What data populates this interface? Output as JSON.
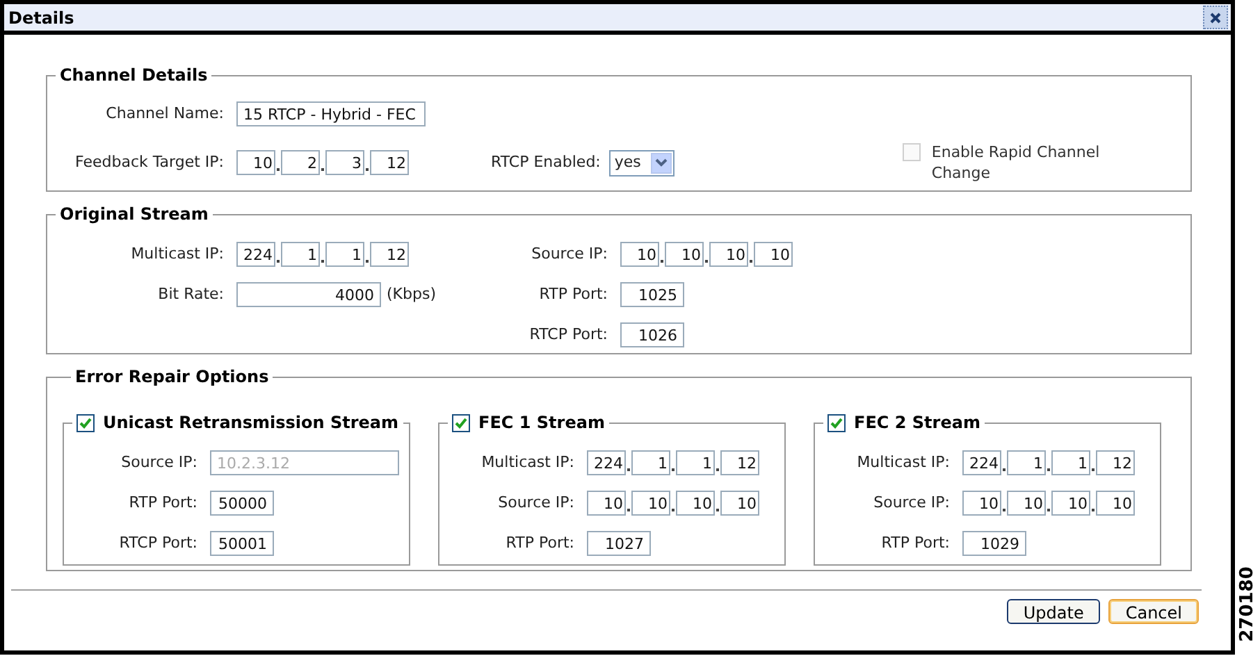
{
  "window": {
    "title": "Details"
  },
  "channel_details": {
    "legend": "Channel Details",
    "channel_name": {
      "label": "Channel Name:",
      "value": "15 RTCP - Hybrid - FEC"
    },
    "feedback_target_ip": {
      "label": "Feedback Target IP:",
      "octets": [
        "10",
        "2",
        "3",
        "12"
      ]
    },
    "rtcp_enabled": {
      "label": "RTCP Enabled:",
      "value": "yes"
    },
    "rapid_channel_change": {
      "label": "Enable Rapid Channel Change",
      "checked": false,
      "disabled": true
    }
  },
  "original_stream": {
    "legend": "Original Stream",
    "left": [
      {
        "kind": "ip",
        "label": "Multicast IP:",
        "octets": [
          "224",
          "1",
          "1",
          "12"
        ]
      },
      {
        "kind": "unit",
        "label": "Bit Rate:",
        "value": "4000",
        "unit": "(Kbps)"
      }
    ],
    "right": [
      {
        "kind": "ip",
        "label": "Source IP:",
        "octets": [
          "10",
          "10",
          "10",
          "10"
        ]
      },
      {
        "kind": "port",
        "label": "RTP Port:",
        "value": "1025"
      },
      {
        "kind": "port",
        "label": "RTCP Port:",
        "value": "1026"
      }
    ]
  },
  "error_repair": {
    "legend": "Error Repair Options",
    "streams": [
      {
        "title": "Unicast Retransmission Stream",
        "checked": true,
        "fields": [
          {
            "kind": "text",
            "label": "Source IP:",
            "value": "10.2.3.12",
            "disabled": true
          },
          {
            "kind": "port",
            "label": "RTP Port:",
            "value": "50000"
          },
          {
            "kind": "port",
            "label": "RTCP Port:",
            "value": "50001"
          }
        ]
      },
      {
        "title": "FEC 1 Stream",
        "checked": true,
        "fields": [
          {
            "kind": "ip",
            "label": "Multicast IP:",
            "octets": [
              "224",
              "1",
              "1",
              "12"
            ]
          },
          {
            "kind": "ip",
            "label": "Source IP:",
            "octets": [
              "10",
              "10",
              "10",
              "10"
            ]
          },
          {
            "kind": "port",
            "label": "RTP Port:",
            "value": "1027"
          }
        ]
      },
      {
        "title": "FEC 2 Stream",
        "checked": true,
        "fields": [
          {
            "kind": "ip",
            "label": "Multicast IP:",
            "octets": [
              "224",
              "1",
              "1",
              "12"
            ]
          },
          {
            "kind": "ip",
            "label": "Source IP:",
            "octets": [
              "10",
              "10",
              "10",
              "10"
            ]
          },
          {
            "kind": "port",
            "label": "RTP Port:",
            "value": "1029"
          }
        ]
      }
    ]
  },
  "buttons": [
    {
      "label": "Update",
      "focused": false
    },
    {
      "label": "Cancel",
      "focused": true
    }
  ],
  "figure_number": "270180"
}
